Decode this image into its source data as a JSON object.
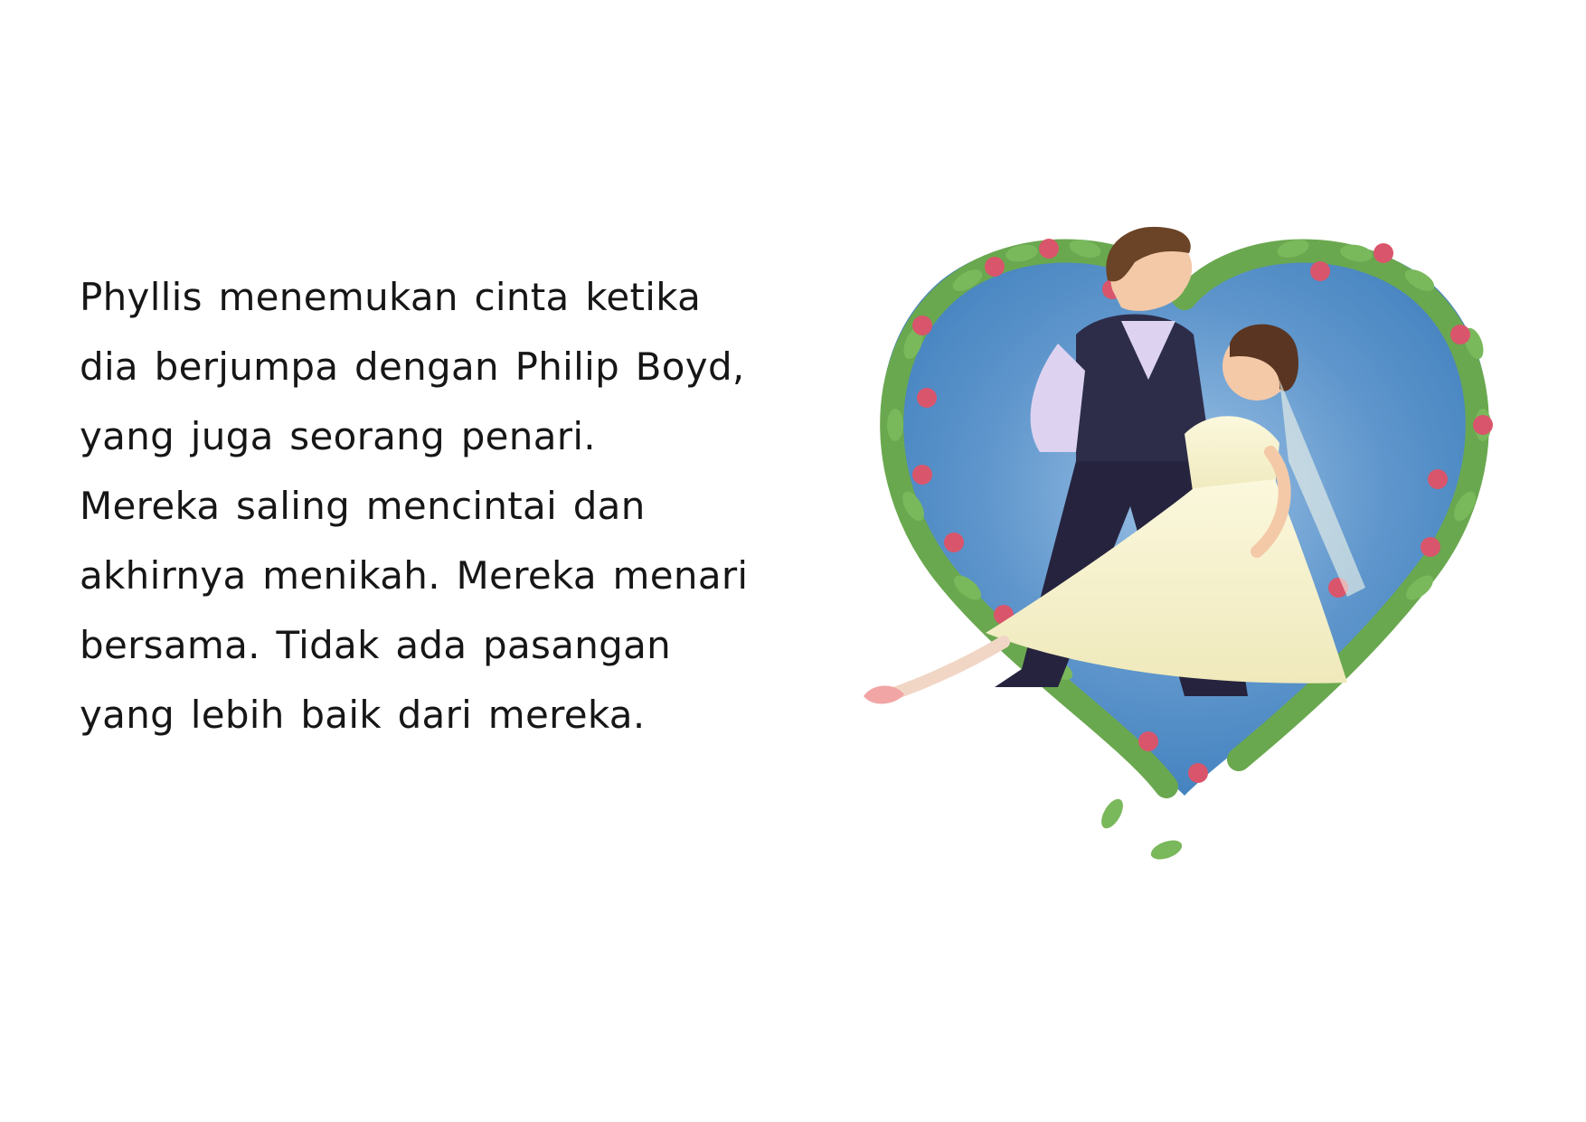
{
  "page": {
    "story_lines": [
      "Phyllis menemukan cinta ketika",
      "dia berjumpa dengan Philip Boyd,",
      "yang juga seorang penari.",
      "Mereka saling mencintai dan",
      "akhirnya menikah. Mereka menari",
      "bersama. Tidak ada pasangan",
      "yang lebih baik dari mereka."
    ]
  },
  "illustration": {
    "subject": "dancing-wedding-couple-in-heart-wreath",
    "colors": {
      "heart_background": "#3f7fbd",
      "wreath_leaves": "#6aa84f",
      "roses": "#d9556b",
      "groom_vest": "#2d2d4a",
      "groom_shirt": "#ddd3f0",
      "bride_dress": "#f6f2cf",
      "ballet_shoes": "#f1a5a5"
    }
  }
}
